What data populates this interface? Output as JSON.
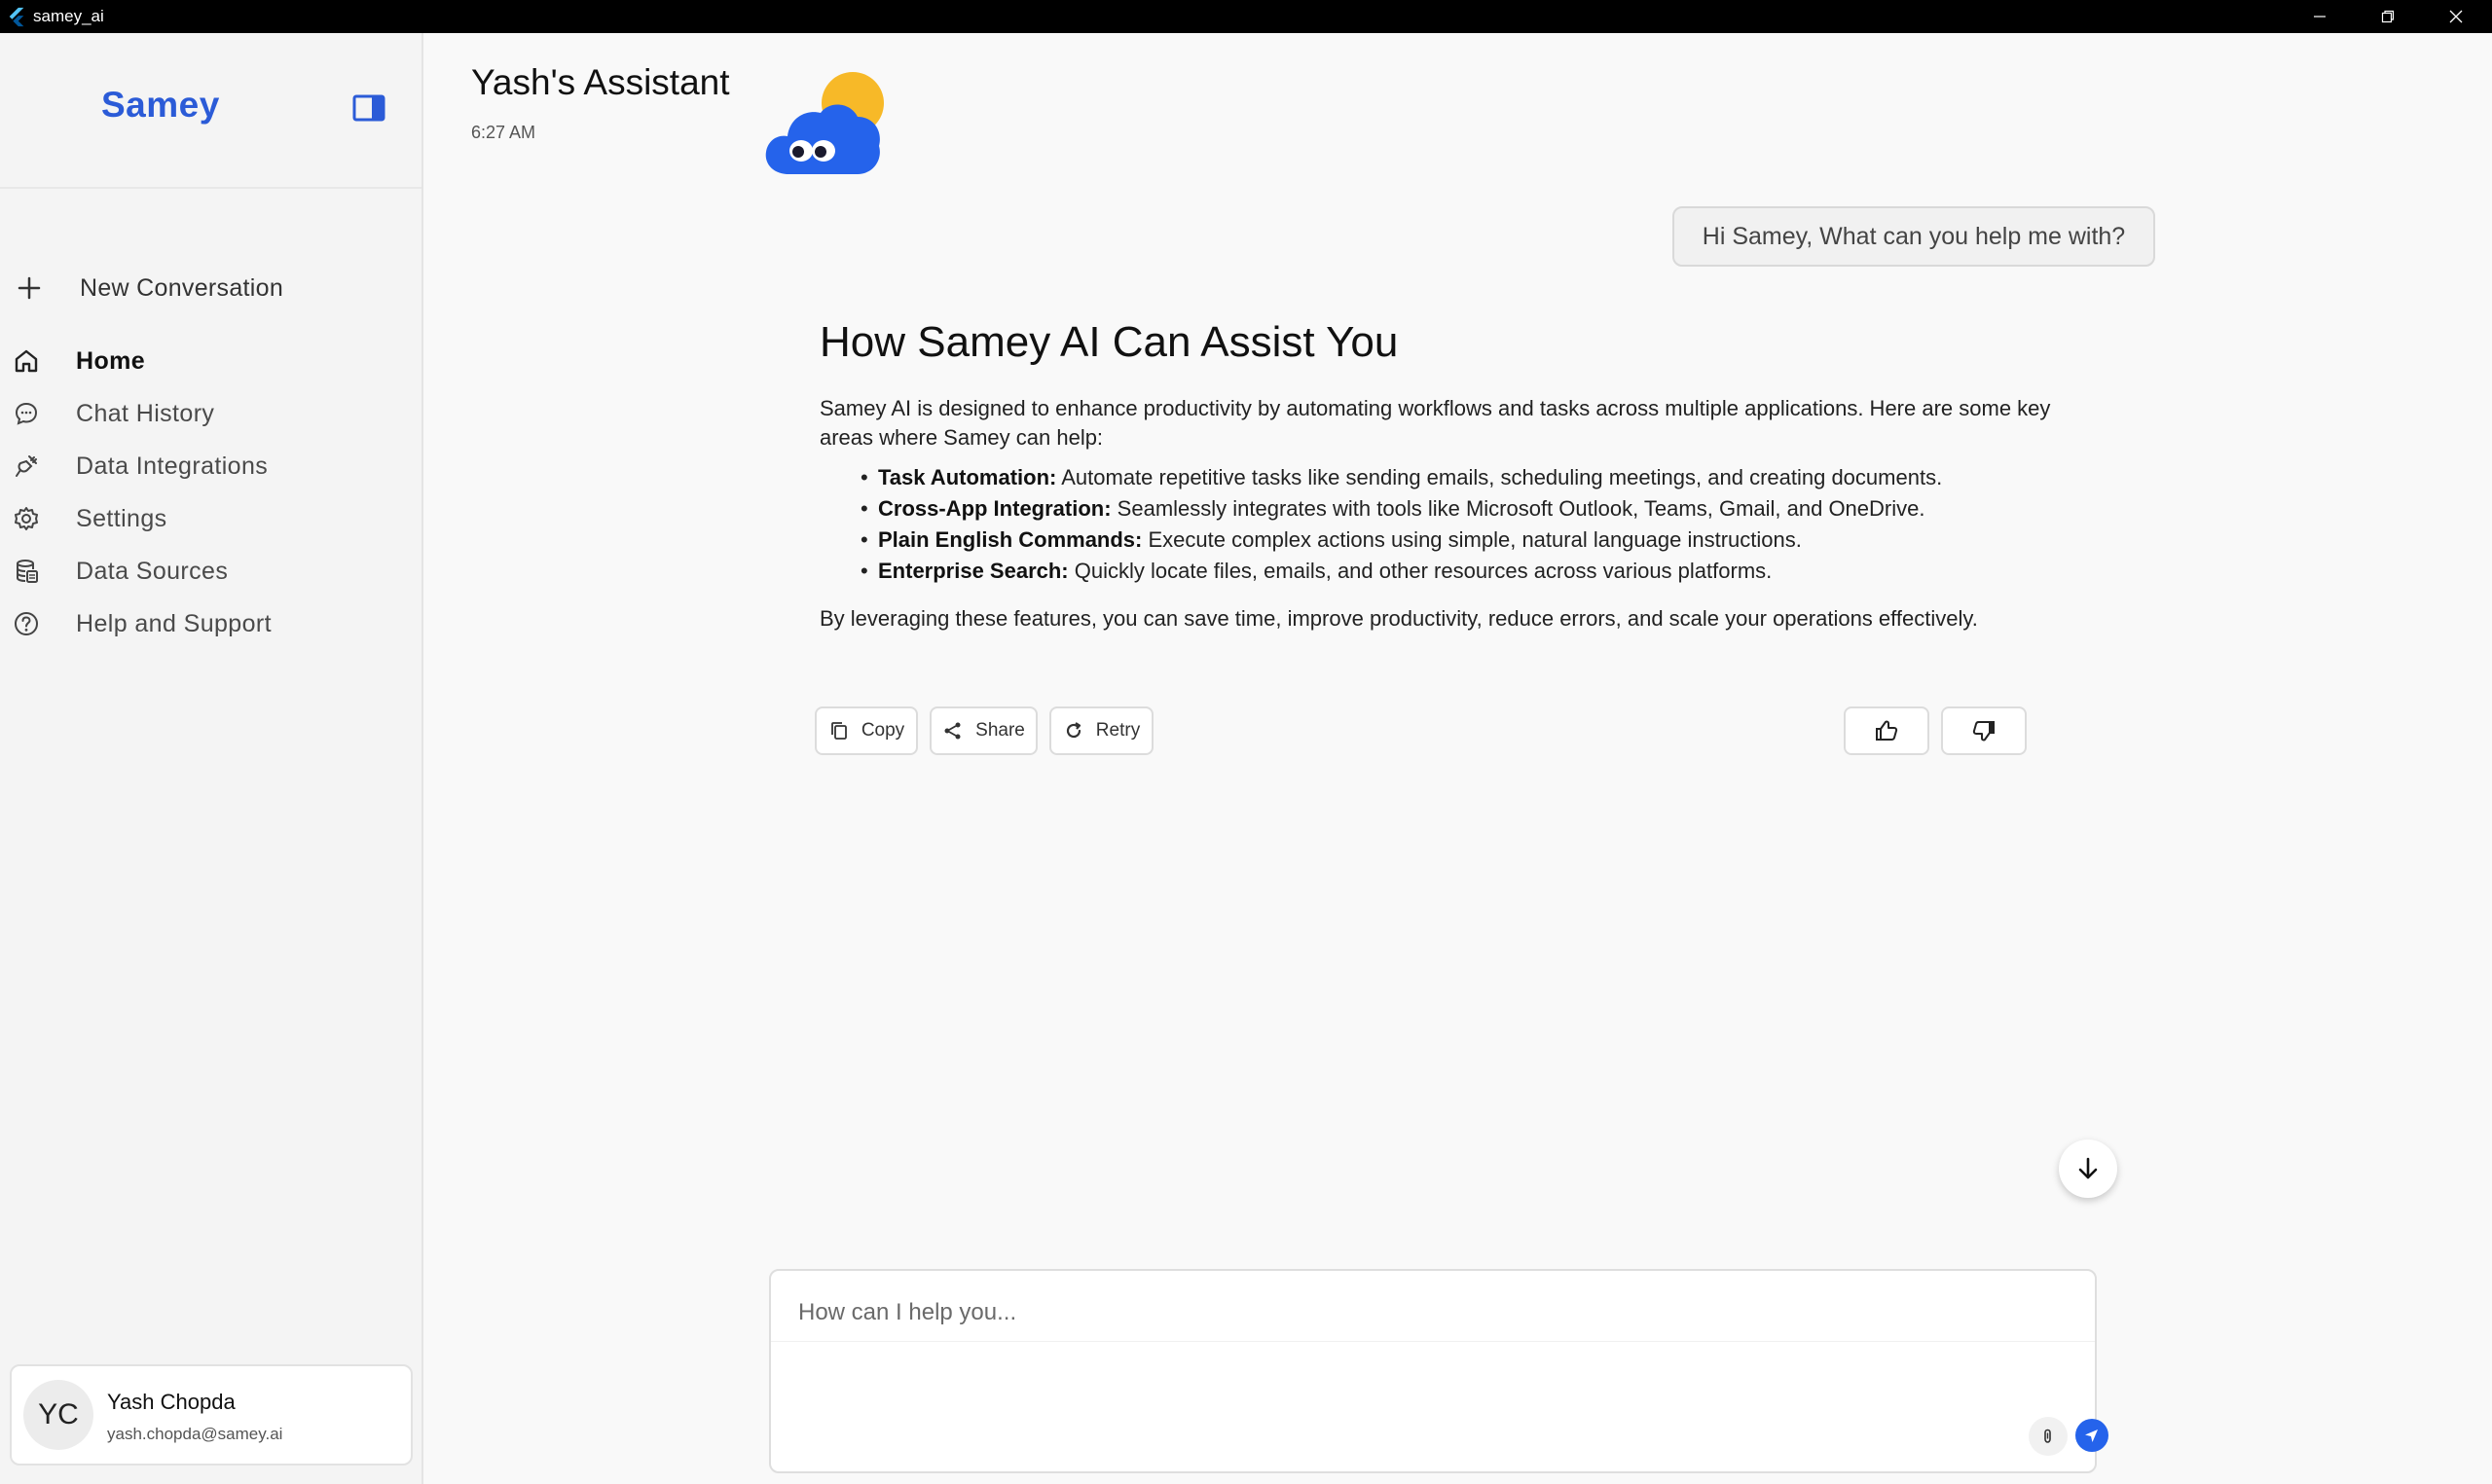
{
  "window": {
    "title": "samey_ai"
  },
  "sidebar": {
    "brand": "Samey",
    "new_conversation": "New Conversation",
    "items": [
      {
        "label": "Home",
        "icon": "home-icon",
        "active": true
      },
      {
        "label": "Chat History",
        "icon": "chat-icon"
      },
      {
        "label": "Data Integrations",
        "icon": "plug-icon"
      },
      {
        "label": "Settings",
        "icon": "gear-icon"
      },
      {
        "label": "Data Sources",
        "icon": "database-icon"
      },
      {
        "label": "Help and Support",
        "icon": "help-icon"
      }
    ],
    "user": {
      "initials": "YC",
      "name": "Yash Chopda",
      "email": "yash.chopda@samey.ai"
    }
  },
  "main": {
    "title": "Yash's Assistant",
    "time": "6:27 AM",
    "user_message": "Hi Samey, What can you help me with?",
    "answer": {
      "heading": "How Samey AI Can Assist You",
      "intro": "Samey AI is designed to enhance productivity by automating workflows and tasks across multiple applications. Here are some key areas where Samey can help:",
      "bullets": [
        {
          "term": "Task Automation:",
          "text": " Automate repetitive tasks like sending emails, scheduling meetings, and creating documents."
        },
        {
          "term": "Cross-App Integration:",
          "text": " Seamlessly integrates with tools like Microsoft Outlook, Teams, Gmail, and OneDrive."
        },
        {
          "term": "Plain English Commands:",
          "text": " Execute complex actions using simple, natural language instructions."
        },
        {
          "term": "Enterprise Search:",
          "text": " Quickly locate files, emails, and other resources across various platforms."
        }
      ],
      "outro": "By leveraging these features, you can save time, improve productivity, reduce errors, and scale your operations effectively."
    },
    "actions": {
      "copy": "Copy",
      "share": "Share",
      "retry": "Retry"
    },
    "composer": {
      "placeholder": "How can I help you..."
    }
  },
  "colors": {
    "accent": "#2563eb",
    "brand": "#2b5bd7"
  }
}
